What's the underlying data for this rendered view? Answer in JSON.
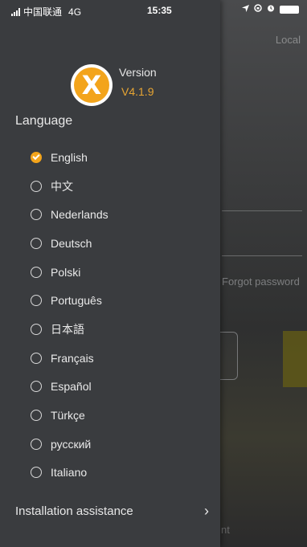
{
  "status_bar": {
    "carrier": "中国联通",
    "network": "4G",
    "time": "15:35",
    "icons": [
      "location-arrow-icon",
      "rotation-lock-icon",
      "alarm-icon",
      "battery-icon"
    ]
  },
  "background": {
    "top_right": "Local",
    "forgot_password": "Forgot password",
    "bottom_text": "nt"
  },
  "drawer": {
    "version_label": "Version",
    "version_value": "V4.1.9",
    "language_title": "Language",
    "languages": [
      {
        "label": "English",
        "selected": true
      },
      {
        "label": "中文",
        "selected": false
      },
      {
        "label": "Nederlands",
        "selected": false
      },
      {
        "label": "Deutsch",
        "selected": false
      },
      {
        "label": "Polski",
        "selected": false
      },
      {
        "label": "Português",
        "selected": false
      },
      {
        "label": "日本語",
        "selected": false
      },
      {
        "label": "Français",
        "selected": false
      },
      {
        "label": "Español",
        "selected": false
      },
      {
        "label": "Türkçe",
        "selected": false
      },
      {
        "label": "русский",
        "selected": false
      },
      {
        "label": "Italiano",
        "selected": false
      }
    ],
    "installation_assistance": "Installation assistance",
    "logo_letter": "X"
  },
  "colors": {
    "accent": "#f3a41b",
    "drawer_bg": "#3a3c3f",
    "version_value": "#e7a533"
  }
}
